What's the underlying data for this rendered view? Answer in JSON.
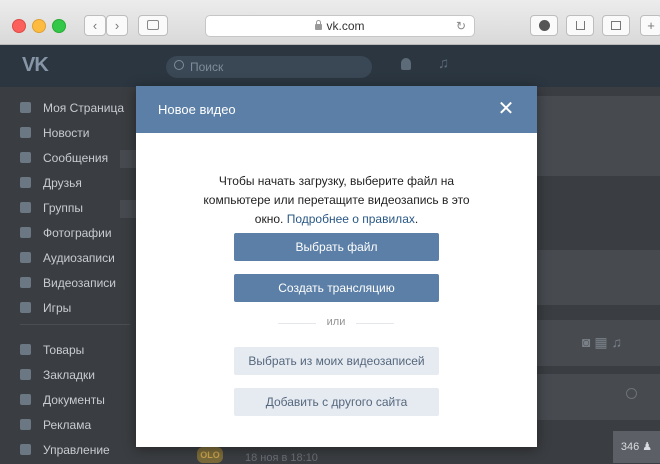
{
  "browser": {
    "url": "vk.com",
    "nav_back": "‹",
    "nav_forward": "›",
    "reload": "↻",
    "new_tab": "+"
  },
  "vk": {
    "logo": "VK",
    "search_placeholder": "Поиск",
    "sidebar": [
      "Моя Страница",
      "Новости",
      "Сообщения",
      "Друзья",
      "Группы",
      "Фотографии",
      "Аудиозаписи",
      "Видеозаписи",
      "Игры",
      "Товары",
      "Закладки",
      "Документы",
      "Реклама",
      "Управление"
    ],
    "post_date": "18 ноя в 18:10",
    "counter": "346"
  },
  "modal": {
    "title": "Новое видео",
    "close": "✕",
    "desc_text": "Чтобы начать загрузку, выберите файл на компьютере или перетащите видеозапись в это окно.",
    "desc_link": "Подробнее о правилах",
    "desc_end": ".",
    "btn_choose_file": "Выбрать файл",
    "btn_create_stream": "Создать трансляцию",
    "or": "или",
    "btn_from_my_videos": "Выбрать из моих видеозаписей",
    "btn_from_other_site": "Добавить с другого сайта"
  },
  "colors": {
    "accent": "#5b7fa6",
    "link": "#2a5885",
    "secondary_bg": "#e6ebf1"
  }
}
